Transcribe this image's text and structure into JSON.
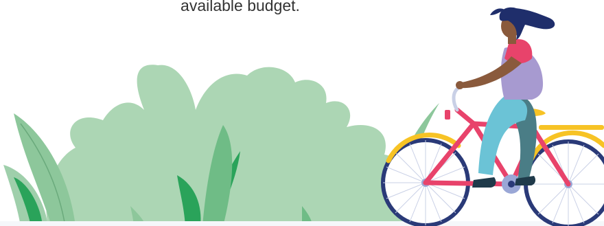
{
  "content": {
    "body_text": "available budget."
  },
  "illustration": {
    "subject": "woman-riding-bicycle",
    "background": "foliage-bushes"
  },
  "colors": {
    "foliage_light": "#acd6b4",
    "foliage_mid": "#8dc79b",
    "foliage_dark": "#2aa35a",
    "bike_frame": "#e8436b",
    "bike_fender": "#f7c325",
    "wheel_rim": "#2a3a78",
    "hair": "#1f2e6b",
    "skin": "#8a5a3c",
    "top": "#a79ad0",
    "sleeve": "#e8436b",
    "pants": "#6bc3d6"
  }
}
